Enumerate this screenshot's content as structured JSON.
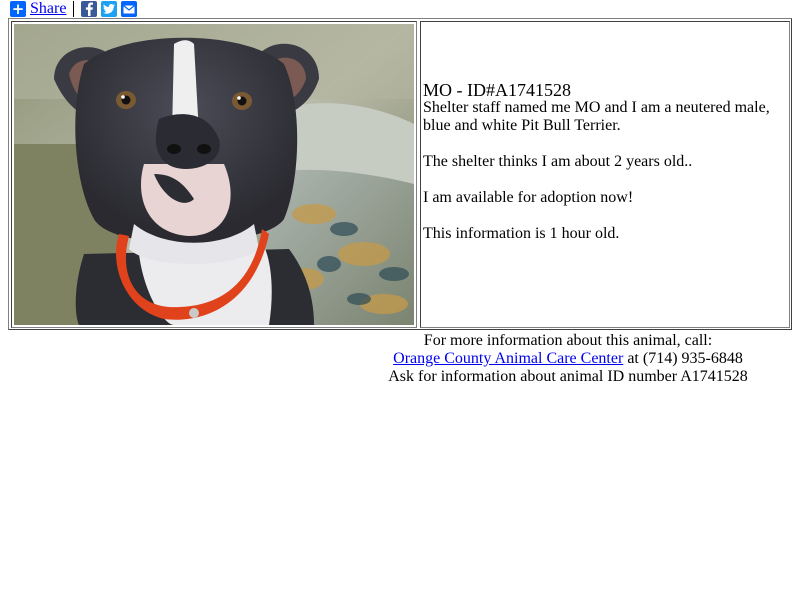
{
  "share": {
    "label": "Share",
    "icons": [
      "plus-icon",
      "facebook-icon",
      "twitter-icon",
      "email-icon"
    ],
    "colors": {
      "plus": "#0166ff",
      "facebook": "#3b5998",
      "twitter": "#1da1f2",
      "email": "#0166ff"
    }
  },
  "animal": {
    "title": "MO - ID#A1741528",
    "description": "Shelter staff named me MO and I am a neutered male, blue and white Pit Bull Terrier.",
    "age": "The shelter thinks I am about 2 years old..",
    "availability": "I am available for adoption now!",
    "freshness": "This information is 1 hour old."
  },
  "contact": {
    "intro": "For more information about this animal, call:",
    "shelter_name": "Orange County Animal Care Center",
    "phone": "at (714) 935-6848",
    "ask": "Ask for information about animal ID number A1741528"
  }
}
